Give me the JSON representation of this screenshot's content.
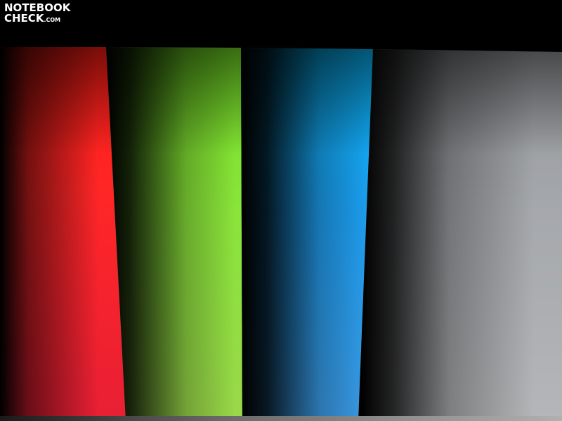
{
  "watermark": {
    "line1": "NOTEBOOK",
    "line2": "CHECK",
    "suffix": ".COM"
  },
  "bands": [
    {
      "color": "red",
      "hex": "#ff2626"
    },
    {
      "color": "green",
      "hex": "#8ae43a"
    },
    {
      "color": "blue",
      "hex": "#1c9ef0"
    },
    {
      "color": "grey",
      "hex": "#a5a8ac"
    }
  ]
}
